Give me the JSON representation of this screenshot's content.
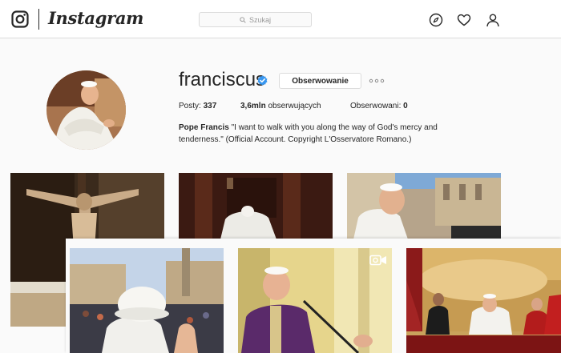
{
  "nav": {
    "wordmark": "Instagram",
    "search_placeholder": "Szukaj",
    "icons": [
      "instagram-glyph-icon",
      "search-icon",
      "compass-icon",
      "heart-icon",
      "person-icon"
    ]
  },
  "profile": {
    "username": "franciscus",
    "verified": true,
    "follow_label": "Obserwowanie",
    "stats": {
      "posts_label": "Posty:",
      "posts_value": "337",
      "followers_value": "3,6mln",
      "followers_label": "obserwujących",
      "following_label": "Obserwowani:",
      "following_value": "0"
    },
    "bio_name": "Pope Francis",
    "bio_text": " \"I want to walk with you along the way of God's mercy and tenderness.\" (Official Account. Copyright L'Osservatore Romano.)"
  },
  "colors": {
    "text": "#262626",
    "border": "#dbdbdb",
    "verified_blue": "#3897f0",
    "background": "#fafafa",
    "vestment_purple": "#5a2a6a"
  },
  "grid": {
    "photos": [
      {
        "name": "photo-crucifix"
      },
      {
        "name": "photo-confession"
      },
      {
        "name": "photo-pope-smiling-square"
      },
      {
        "name": "photo-pope-back-crowd"
      },
      {
        "name": "photo-pope-purple-vestments",
        "video": true
      },
      {
        "name": "photo-papal-balcony"
      }
    ]
  }
}
